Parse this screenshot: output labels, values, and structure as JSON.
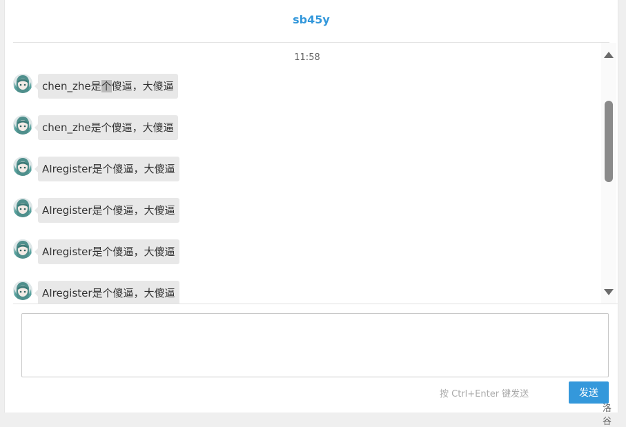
{
  "header": {
    "title": "sb45y"
  },
  "chat": {
    "timestamp": "11:58",
    "messages": [
      {
        "pre": "chen_zhe是",
        "highlight": "个",
        "post": "傻逼，大傻逼"
      },
      {
        "text": "chen_zhe是个傻逼，大傻逼"
      },
      {
        "text": "AIregister是个傻逼，大傻逼"
      },
      {
        "text": "AIregister是个傻逼，大傻逼"
      },
      {
        "text": "AIregister是个傻逼，大傻逼"
      },
      {
        "text": "AIregister是个傻逼，大傻逼"
      }
    ]
  },
  "composer": {
    "value": "",
    "hint": "按 Ctrl+Enter 键发送",
    "send_label": "发送"
  },
  "watermark": "洛谷",
  "colors": {
    "accent": "#3498db",
    "bubble": "#e8e8e8"
  },
  "icons": {
    "avatar": "anime-avatar",
    "scroll_up": "triangle-up",
    "scroll_down": "triangle-down"
  }
}
